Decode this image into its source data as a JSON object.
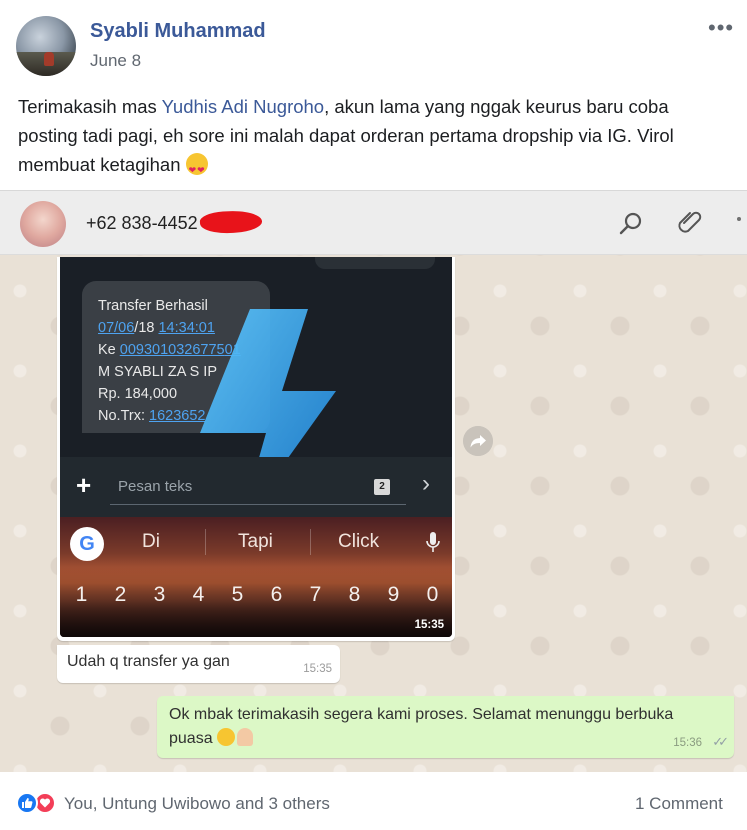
{
  "post": {
    "author": "Syabli Muhammad",
    "date": "June 8",
    "text_before": "Terimakasih mas ",
    "mention": "Yudhis Adi Nugroho",
    "text_after": ", akun lama yang nggak keurus baru coba posting tadi pagi, eh sore ini malah dapat orderan pertama dropship via IG. Virol membuat ketagihan ",
    "emoji": "heart-eyes-emoji"
  },
  "whatsapp": {
    "contact_phone": "+62 838-4452",
    "sms": {
      "line1": "Transfer Berhasil",
      "date": "07/06",
      "date_rest": "/18 ",
      "time": "14:34:01",
      "to_label": "Ke ",
      "account": "0093010326775",
      "account_tail": "01",
      "name": "M SYABLI ZA S IP",
      "amount": "Rp. 184,000",
      "trx_label": "No.Trx: ",
      "trx": "1623652"
    },
    "compose_placeholder": "Pesan teks",
    "sim_label": "2",
    "suggestions": [
      "Di",
      "Tapi",
      "Click"
    ],
    "digits": [
      "1",
      "2",
      "3",
      "4",
      "5",
      "6",
      "7",
      "8",
      "9",
      "0"
    ],
    "image_time": "15:35",
    "incoming": {
      "text": "Udah q transfer ya gan",
      "time": "15:35"
    },
    "outgoing": {
      "text": "Ok mbak terimakasih segera kami proses. Selamat menunggu berbuka puasa ",
      "time": "15:36",
      "ticks": "✓✓"
    }
  },
  "footer": {
    "reactions": "You, Untung Uwibowo and 3 others",
    "comments": "1 Comment"
  },
  "colors": {
    "facebook_blue": "#3b5998",
    "whatsapp_outgoing": "#dcf8c6",
    "whatsapp_bg": "#e9e1d6",
    "like_blue": "#1877f2",
    "love_red": "#f33e58"
  }
}
